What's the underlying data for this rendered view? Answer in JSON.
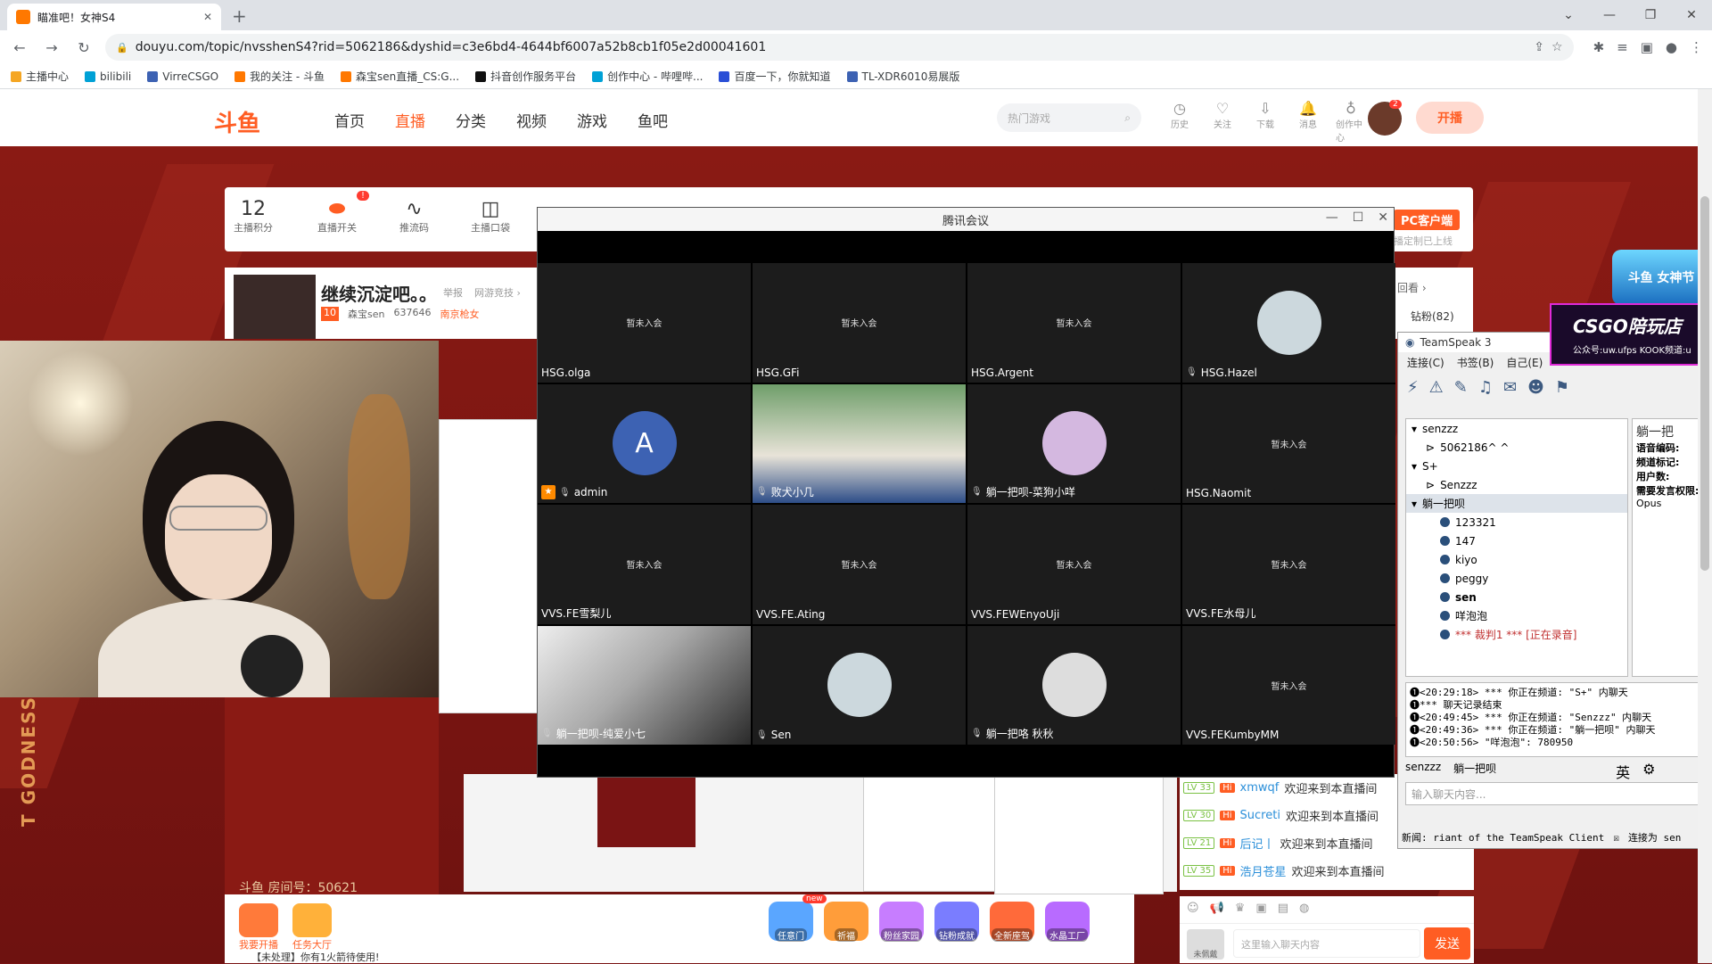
{
  "browser": {
    "tab_title": "瞄准吧！女神S4",
    "url": "douyu.com/topic/nvsshenS4?rid=5062186&dyshid=c3e6bd4-4644bf6007a52b8cb1f05e2d00041601",
    "bookmarks": [
      "主播中心",
      "bilibili",
      "VirreCSGO",
      "我的关注 - 斗鱼",
      "森宝sen直播_CS:G...",
      "抖音创作服务平台",
      "创作中心 - 哔哩哔...",
      "百度一下，你就知道",
      "TL-XDR6010易展版"
    ]
  },
  "douyu": {
    "logo": "斗鱼",
    "nav": [
      "首页",
      "直播",
      "分类",
      "视频",
      "游戏",
      "鱼吧"
    ],
    "search_placeholder": "热门游戏",
    "icons": [
      "历史",
      "关注",
      "下载",
      "消息",
      "创作中心"
    ],
    "msg_badge": "2",
    "avatar_badge": "2",
    "live_button": "开播",
    "anchor_bar": {
      "score_value": "12",
      "score_label": "主播积分",
      "live_switch_label": "直播开关",
      "push_code_label": "推流码",
      "pocket_label": "主播口袋",
      "notify_badge": "!",
      "pc_client": "PC客户端",
      "pc_sub": "播定制已上线"
    },
    "room": {
      "title": "继续沉淀吧。。",
      "report": "举报",
      "category": "网游竞技 ›",
      "anchor_name": "森宝sen",
      "heat": "637646",
      "region_tag": "南京枪女",
      "level_badge": "10",
      "watch_back": "回看 ›",
      "diamond_fans": "钻粉(82)"
    },
    "room_number": "斗鱼 房间号：50621",
    "goddess_text": "T GODNESS",
    "bottom_buttons": [
      "我要开播",
      "任务大厅"
    ],
    "gifts": [
      "任意门",
      "祈福",
      "粉丝家园",
      "钻粉成就",
      "全新座驾",
      "水晶工厂"
    ],
    "gift_new_badge": "new",
    "notice": "【未处理】你有1火箭待使用!",
    "chat": [
      {
        "lv": "LV 33",
        "user": "xmwqf",
        "text": "欢迎来到本直播间"
      },
      {
        "lv": "LV 30",
        "user": "Sucreti",
        "text": "欢迎来到本直播间"
      },
      {
        "lv": "LV 21",
        "user": "后记丨",
        "text": "欢迎来到本直播间"
      },
      {
        "lv": "LV 35",
        "user": "浩月苍星",
        "text": "欢迎来到本直播间"
      }
    ],
    "chat_hi": "Hi",
    "chat_input_placeholder": "这里输入聊天内容",
    "chat_send": "发送",
    "chat_avatar_label": "未佩戴"
  },
  "meeting": {
    "title": "腾讯会议",
    "not_joined": "暂未入会",
    "tiles": [
      {
        "name": "HSG.olga",
        "state": "off"
      },
      {
        "name": "HSG.GFi",
        "state": "off"
      },
      {
        "name": "HSG.Argent",
        "state": "off"
      },
      {
        "name": "HSG.Hazel",
        "state": "avatar"
      },
      {
        "name": "admin",
        "state": "letter",
        "letter": "A"
      },
      {
        "name": "败犬小几",
        "state": "video"
      },
      {
        "name": "躺一把呗-菜狗小咩",
        "state": "avatar"
      },
      {
        "name": "HSG.Naomit",
        "state": "off"
      },
      {
        "name": "VVS.FE雪梨儿",
        "state": "off"
      },
      {
        "name": "VVS.FE.Ating",
        "state": "off"
      },
      {
        "name": "VVS.FEWEnyoUji",
        "state": "off"
      },
      {
        "name": "VVS.FE水母儿",
        "state": "off"
      },
      {
        "name": "躺一把呗-纯爱小七",
        "state": "video"
      },
      {
        "name": "Sen",
        "state": "avatar"
      },
      {
        "name": "躺一把咯 秋秋",
        "state": "avatar"
      },
      {
        "name": "VVS.FEKumbyMM",
        "state": "off"
      }
    ]
  },
  "teamspeak": {
    "title": "TeamSpeak 3",
    "menu": [
      "连接(C)",
      "书签(B)",
      "自己(E)"
    ],
    "tree": [
      {
        "label": "senzzz",
        "indent": 0
      },
      {
        "label": "5062186^ ^",
        "indent": 1
      },
      {
        "label": "S+",
        "indent": 0
      },
      {
        "label": "Senzzz",
        "indent": 1
      },
      {
        "label": "躺一把呗",
        "indent": 0
      },
      {
        "label": "123321",
        "indent": 2
      },
      {
        "label": "147",
        "indent": 2
      },
      {
        "label": "kiyo",
        "indent": 2
      },
      {
        "label": "peggy",
        "indent": 2
      },
      {
        "label": "sen",
        "indent": 2
      },
      {
        "label": "咩泡泡",
        "indent": 2
      },
      {
        "label": "*** 裁判1 *** [正在录音]",
        "indent": 2
      }
    ],
    "info_header": "躺一把",
    "info_lines": [
      "语音编码:",
      "频道标记:",
      "用户数:",
      "需要发言权限:"
    ],
    "info_codec": "Opus",
    "log": [
      "❶<20:29:18> *** 你正在频道: \"S+\" 内聊天",
      "❶*** 聊天记录结束",
      "❶<20:49:45> *** 你正在频道: \"Senzzz\" 内聊天",
      "❶<20:49:36> *** 你正在频道: \"躺一把呗\" 内聊天",
      "❶<20:50:56> \"咩泡泡\": 780950"
    ],
    "tabs": [
      "senzzz",
      "躺一把呗"
    ],
    "input_placeholder": "输入聊天内容...",
    "status_left": "新闻: riant of the TeamSpeak Client",
    "status_right": "连接为 sen",
    "ime": "英"
  },
  "ad": {
    "top": "斗鱼 女神节",
    "title": "CSGO陪玩店",
    "sub": "公众号:uw.ufps KOOK频道:u"
  }
}
